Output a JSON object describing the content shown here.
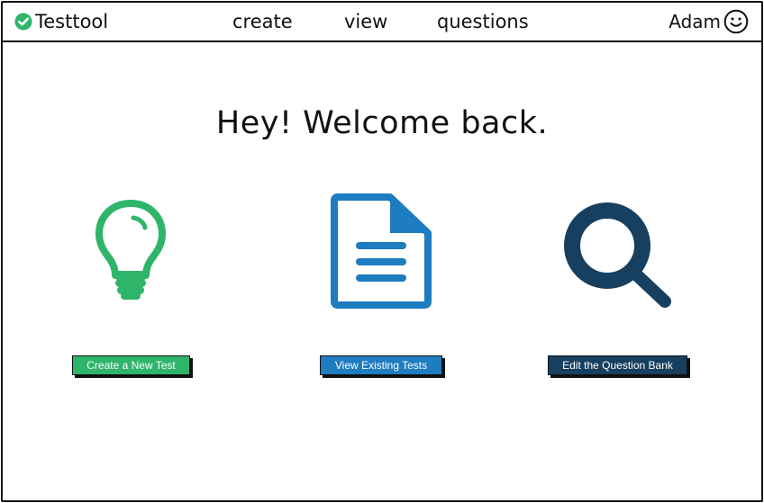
{
  "app": {
    "title": "Testtool",
    "brand_icon": "check-circle-icon"
  },
  "nav": {
    "links": [
      {
        "label": "create"
      },
      {
        "label": "view"
      },
      {
        "label": "questions"
      }
    ]
  },
  "user": {
    "name": "Adam",
    "icon": "smiley-face-icon"
  },
  "main": {
    "welcome": "Hey! Welcome back.",
    "actions": [
      {
        "icon": "lightbulb-icon",
        "label": "Create a New Test",
        "color": "#2eb56a"
      },
      {
        "icon": "document-icon",
        "label": "View Existing Tests",
        "color": "#1e7cc0"
      },
      {
        "icon": "search-icon",
        "label": "Edit the Question Bank",
        "color": "#173f5f"
      }
    ]
  }
}
